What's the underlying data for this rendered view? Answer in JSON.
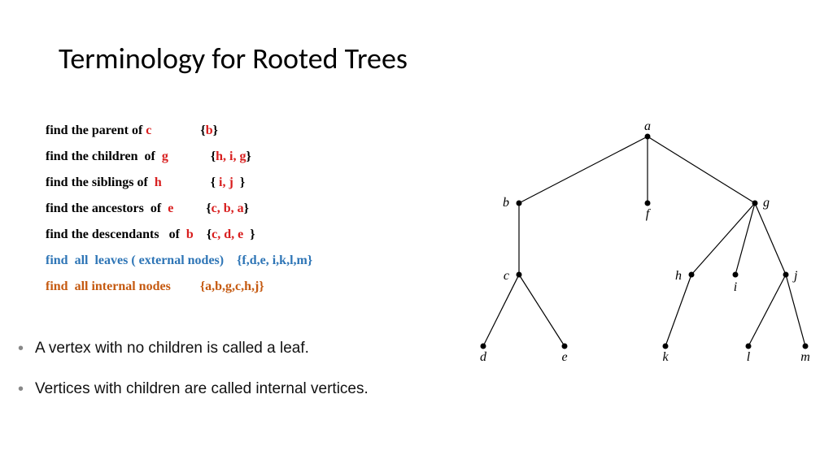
{
  "title": "Terminology for Rooted Trees",
  "rows": {
    "parent": {
      "q": "find the parent of ",
      "subj": "c",
      "ans": "b"
    },
    "children": {
      "q": "find the children  of  ",
      "subj": "g",
      "ans": "h, i, g"
    },
    "siblings": {
      "q": "find the siblings of  ",
      "subj": "h",
      "ans": " i, j "
    },
    "ancestors": {
      "q": "find the ancestors  of  ",
      "subj": "e",
      "ans": "c, b, a"
    },
    "descendants": {
      "q": "find the descendants   of  ",
      "subj": "b",
      "ans": "c, d, e "
    },
    "leaves": {
      "q": "find  all  leaves ( external nodes)    ",
      "ans": "{f,d,e, i,k,l,m}"
    },
    "internal": {
      "q": "find  all internal nodes         ",
      "ans": "{a,b,g,c,h,j}"
    }
  },
  "bullets": {
    "b1": "A vertex with no children is called a leaf.",
    "b2": "Vertices with children are called internal vertices."
  },
  "tree": {
    "nodes": {
      "a": "a",
      "b": "b",
      "c": "c",
      "d": "d",
      "e": "e",
      "f": "f",
      "g": "g",
      "h": "h",
      "i": "i",
      "j": "j",
      "k": "k",
      "l": "l",
      "m": "m"
    }
  },
  "chart_data": {
    "type": "tree",
    "root": "a",
    "edges": [
      [
        "a",
        "b"
      ],
      [
        "a",
        "f"
      ],
      [
        "a",
        "g"
      ],
      [
        "b",
        "c"
      ],
      [
        "c",
        "d"
      ],
      [
        "c",
        "e"
      ],
      [
        "g",
        "h"
      ],
      [
        "g",
        "i"
      ],
      [
        "g",
        "j"
      ],
      [
        "h",
        "k"
      ],
      [
        "j",
        "l"
      ],
      [
        "j",
        "m"
      ]
    ],
    "leaves": [
      "d",
      "e",
      "f",
      "i",
      "k",
      "l",
      "m"
    ],
    "internal": [
      "a",
      "b",
      "g",
      "c",
      "h",
      "j"
    ]
  }
}
